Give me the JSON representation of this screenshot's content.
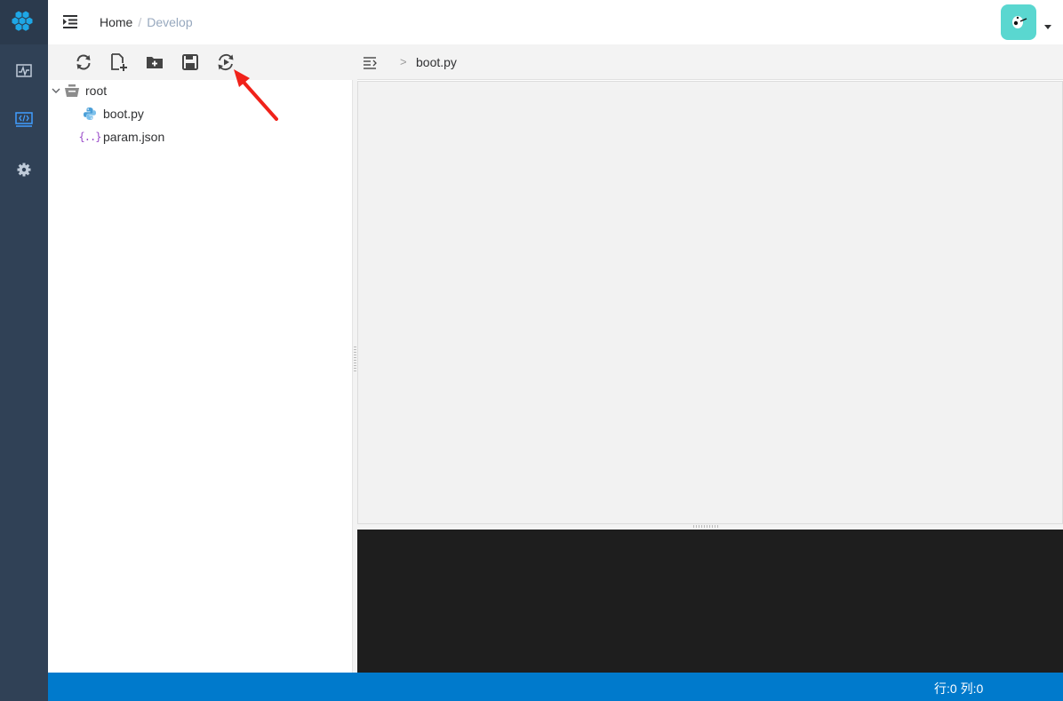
{
  "rail": {
    "logo_icon": "hexagon-cluster-logo",
    "items": [
      {
        "icon": "activity-monitor-icon",
        "active": false
      },
      {
        "icon": "code-editor-icon",
        "active": true
      },
      {
        "icon": "gear-icon",
        "active": false
      }
    ],
    "active_color": "#409eff",
    "icon_color": "#bfcbd9"
  },
  "header": {
    "breadcrumb": {
      "home": "Home",
      "separator": "/",
      "current": "Develop"
    },
    "avatar_color": "#5ad7d0"
  },
  "explorer": {
    "toolbar": [
      {
        "icon": "refresh-icon"
      },
      {
        "icon": "new-file-icon"
      },
      {
        "icon": "new-folder-icon"
      },
      {
        "icon": "save-icon"
      },
      {
        "icon": "run-icon"
      }
    ],
    "tree": {
      "root_label": "root",
      "children": [
        {
          "label": "boot.py",
          "icon": "python-icon"
        },
        {
          "label": "param.json",
          "icon": "json-icon",
          "glyph": "{..}"
        }
      ]
    }
  },
  "editor": {
    "breadcrumb_chevron": ">",
    "open_file": "boot.py",
    "background": "#f2f2f2"
  },
  "terminal": {
    "background": "#1e1e1e"
  },
  "statusbar": {
    "position": "行:0 列:0",
    "background": "#007acc"
  },
  "annotation": {
    "arrow_color": "#f0221a",
    "points_to": "run-icon"
  }
}
